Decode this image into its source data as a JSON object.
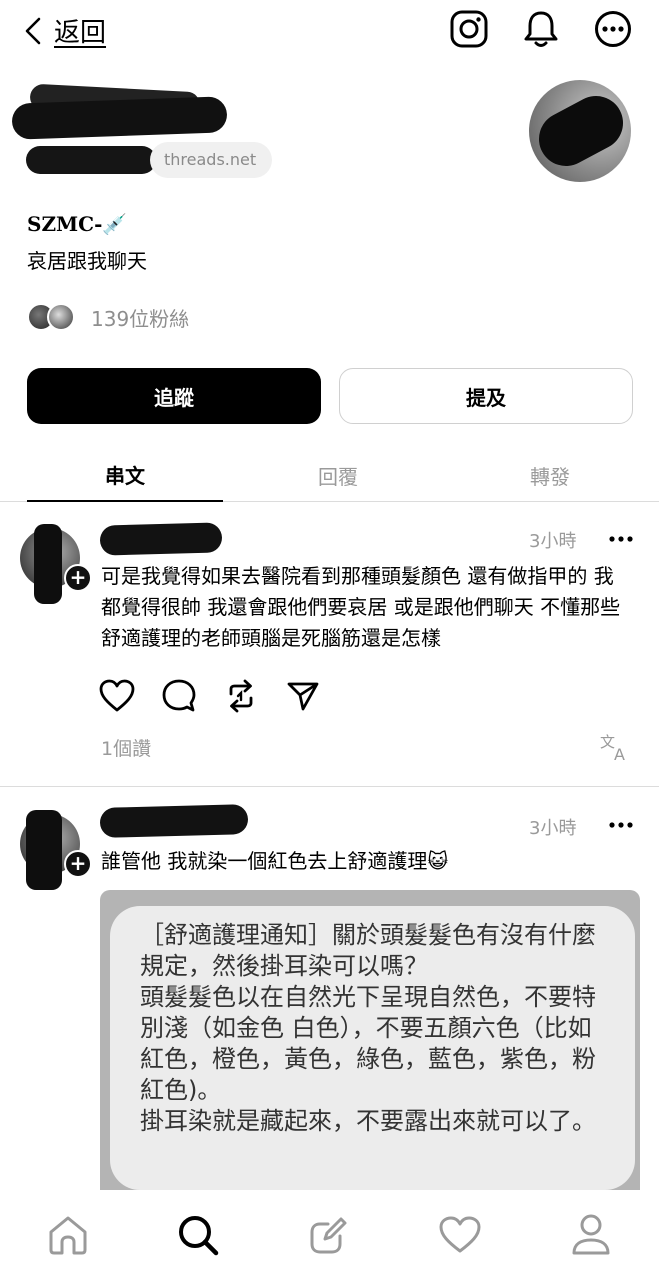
{
  "topbar": {
    "back_label": "返回",
    "icons": [
      "instagram-icon",
      "bell-icon",
      "more-icon"
    ]
  },
  "profile": {
    "handle_suffix": "threads.net",
    "bio_title": "SZMC-💉",
    "bio_line": "哀居跟我聊天",
    "followers_label": "139位粉絲"
  },
  "buttons": {
    "follow": "追蹤",
    "mention": "提及"
  },
  "tabs": [
    "串文",
    "回覆",
    "轉發"
  ],
  "active_tab": "串文",
  "posts": [
    {
      "time": "3小時",
      "text": "可是我覺得如果去醫院看到那種頭髮顏色 還有做指甲的 我都覺得很帥 我還會跟他們要哀居 或是跟他們聊天 不懂那些舒適護理的老師頭腦是死腦筋還是怎樣",
      "likes": "1個讚"
    },
    {
      "time": "3小時",
      "text": "誰管他 我就染一個紅色去上舒適護理😺",
      "embedded_text": "［舒適護理通知］關於頭髮髮色有沒有什麼規定，然後掛耳染可以嗎？\n頭髮髮色以在自然光下呈現自然色，不要特別淺（如金色 白色），不要五顏六色（比如紅色，橙色，黃色，綠色，藍色，紫色，粉紅色)。\n掛耳染就是藏起來，不要露出來就可以了。"
    }
  ],
  "bottom_nav": [
    "home-icon",
    "search-icon",
    "compose-icon",
    "activity-heart-icon",
    "profile-icon"
  ],
  "colors": {
    "accent": "#000000",
    "muted": "#9a9a9a",
    "divider": "#dcdcdc"
  }
}
